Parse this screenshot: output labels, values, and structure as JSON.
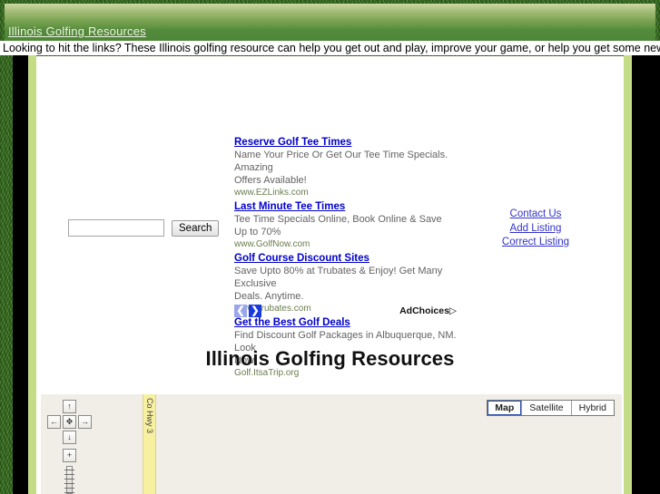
{
  "header": {
    "site_link": "Illinois Golfing Resources ",
    "tagline": "Looking to hit the links? These Illinois golfing resource can help you get out and play, improve your game, or help you get some new gear."
  },
  "search": {
    "value": "",
    "placeholder": "",
    "button_label": "Search"
  },
  "ads": {
    "items": [
      {
        "title": "Reserve Golf Tee Times",
        "desc1": "Name Your Price Or Get Our Tee Time Specials. Amazing",
        "desc2": "Offers Available!",
        "url": "www.EZLinks.com"
      },
      {
        "title": "Last Minute Tee Times",
        "desc1": "Tee Time Specials Online, Book Online & Save Up to 70%",
        "desc2": "",
        "url": "www.GolfNow.com"
      },
      {
        "title": "Golf Course Discount Sites",
        "desc1": "Save Upto 80% at Trubates & Enjoy! Get Many Exclusive",
        "desc2": "Deals. Anytime.",
        "url": "www.Trubates.com"
      },
      {
        "title": "Get the Best Golf Deals",
        "desc1": "Find Discount Golf Packages in Albuquerque, NM. Look",
        "desc2": "Now!",
        "url": "Golf.ItsaTrip.org"
      }
    ],
    "prev_label": "❮",
    "next_label": "❯",
    "adchoices_label": "AdChoices",
    "adchoices_icon": "▷"
  },
  "util_links": [
    {
      "label": "Contact Us "
    },
    {
      "label": "Add Listing"
    },
    {
      "label": "Correct Listing"
    }
  ],
  "page": {
    "title": "Illinois Golfing Resources"
  },
  "map": {
    "road_label": "Co Hwy 3",
    "pan_up": "↑",
    "pan_left": "←",
    "pan_center": "✥",
    "pan_right": "→",
    "pan_down": "↓",
    "zoom_in": "+",
    "types": [
      {
        "label": "Map",
        "active": true
      },
      {
        "label": "Satellite",
        "active": false
      },
      {
        "label": "Hybrid",
        "active": false
      }
    ]
  },
  "colors": {
    "banner_green": "#548a3b",
    "frame_lime": "#c4dc85",
    "ad_link_blue": "#0000cc",
    "util_link_blue": "#3333cc",
    "map_bg": "#f1eee7",
    "road_yellow": "#f7f0a0"
  }
}
